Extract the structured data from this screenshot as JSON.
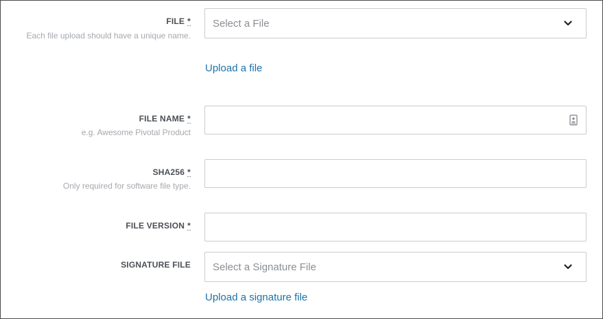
{
  "form": {
    "file": {
      "label": "FILE",
      "required_mark": "*",
      "hint": "Each file upload should have a unique name.",
      "select_placeholder": "Select a File",
      "upload_link": "Upload a file"
    },
    "file_name": {
      "label": "FILE NAME",
      "required_mark": "*",
      "hint": "e.g. Awesome Pivotal Product",
      "value": ""
    },
    "sha256": {
      "label": "SHA256",
      "required_mark": "*",
      "hint": "Only required for software file type.",
      "value": ""
    },
    "file_version": {
      "label": "FILE VERSION",
      "required_mark": "*",
      "value": ""
    },
    "signature_file": {
      "label": "SIGNATURE FILE",
      "select_placeholder": "Select a Signature File",
      "upload_link": "Upload a signature file"
    }
  },
  "icons": {
    "select_chevron": "chevron-down-icon",
    "field_helper": "contact-card-icon"
  },
  "colors": {
    "label": "#4b4f54",
    "hint": "#a4a8ad",
    "link": "#1a73a8",
    "border": "#c8cbcf"
  }
}
